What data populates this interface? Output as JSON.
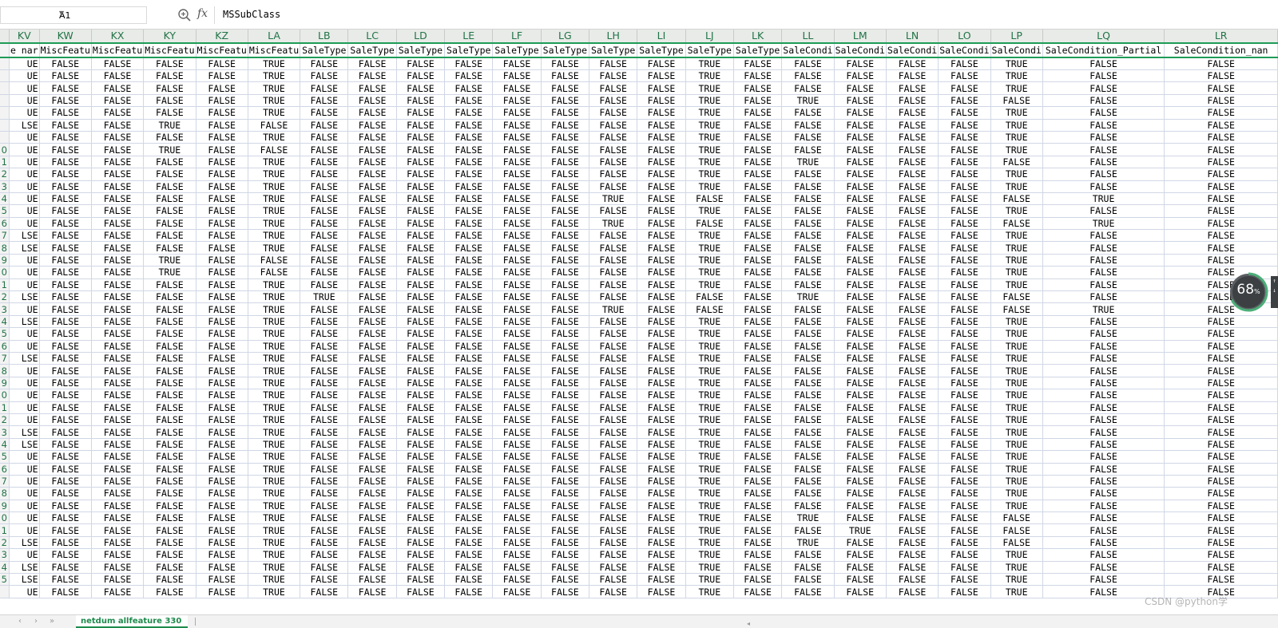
{
  "formula_bar": {
    "name_box": "A1",
    "fx_label": "fx",
    "formula": "MSSubClass"
  },
  "columns": [
    "KV",
    "KW",
    "KX",
    "KY",
    "KZ",
    "LA",
    "LB",
    "LC",
    "LD",
    "LE",
    "LF",
    "LG",
    "LH",
    "LI",
    "LJ",
    "LK",
    "LL",
    "LM",
    "LN",
    "LO",
    "LP",
    "LQ",
    "LR"
  ],
  "header_row": [
    "e nar",
    "MiscFeatu",
    "MiscFeatu",
    "MiscFeatu",
    "MiscFeatu",
    "MiscFeatu",
    "SaleType",
    "SaleType",
    "SaleType",
    "SaleType",
    "SaleType",
    "SaleType",
    "SaleType",
    "SaleType",
    "SaleType",
    "SaleType",
    "SaleCondi",
    "SaleCondi",
    "SaleCondi",
    "SaleCondi",
    "SaleCondi",
    "SaleCondition_Partial",
    "SaleCondition_nan"
  ],
  "row_numbers": [
    "",
    "",
    "",
    "",
    "",
    "",
    "",
    "",
    "0",
    "1",
    "2",
    "3",
    "4",
    "5",
    "6",
    "7",
    "8",
    "9",
    "0",
    "1",
    "2",
    "3",
    "4",
    "5",
    "6",
    "7",
    "8",
    "9",
    "0",
    "1",
    "2",
    "3",
    "4",
    "5",
    "6",
    "7",
    "8",
    "9",
    "0",
    "1",
    "2",
    "3",
    "4",
    "5"
  ],
  "rows": [
    [
      "UE",
      "FALSE",
      "FALSE",
      "FALSE",
      "FALSE",
      "TRUE",
      "FALSE",
      "FALSE",
      "FALSE",
      "FALSE",
      "FALSE",
      "FALSE",
      "FALSE",
      "FALSE",
      "TRUE",
      "FALSE",
      "FALSE",
      "FALSE",
      "FALSE",
      "FALSE",
      "TRUE",
      "FALSE",
      "FALSE"
    ],
    [
      "UE",
      "FALSE",
      "FALSE",
      "FALSE",
      "FALSE",
      "TRUE",
      "FALSE",
      "FALSE",
      "FALSE",
      "FALSE",
      "FALSE",
      "FALSE",
      "FALSE",
      "FALSE",
      "TRUE",
      "FALSE",
      "FALSE",
      "FALSE",
      "FALSE",
      "FALSE",
      "TRUE",
      "FALSE",
      "FALSE"
    ],
    [
      "UE",
      "FALSE",
      "FALSE",
      "FALSE",
      "FALSE",
      "TRUE",
      "FALSE",
      "FALSE",
      "FALSE",
      "FALSE",
      "FALSE",
      "FALSE",
      "FALSE",
      "FALSE",
      "TRUE",
      "FALSE",
      "FALSE",
      "FALSE",
      "FALSE",
      "FALSE",
      "TRUE",
      "FALSE",
      "FALSE"
    ],
    [
      "UE",
      "FALSE",
      "FALSE",
      "FALSE",
      "FALSE",
      "TRUE",
      "FALSE",
      "FALSE",
      "FALSE",
      "FALSE",
      "FALSE",
      "FALSE",
      "FALSE",
      "FALSE",
      "TRUE",
      "FALSE",
      "TRUE",
      "FALSE",
      "FALSE",
      "FALSE",
      "FALSE",
      "FALSE",
      "FALSE"
    ],
    [
      "UE",
      "FALSE",
      "FALSE",
      "FALSE",
      "FALSE",
      "TRUE",
      "FALSE",
      "FALSE",
      "FALSE",
      "FALSE",
      "FALSE",
      "FALSE",
      "FALSE",
      "FALSE",
      "TRUE",
      "FALSE",
      "FALSE",
      "FALSE",
      "FALSE",
      "FALSE",
      "TRUE",
      "FALSE",
      "FALSE"
    ],
    [
      "LSE",
      "FALSE",
      "FALSE",
      "TRUE",
      "FALSE",
      "FALSE",
      "FALSE",
      "FALSE",
      "FALSE",
      "FALSE",
      "FALSE",
      "FALSE",
      "FALSE",
      "FALSE",
      "TRUE",
      "FALSE",
      "FALSE",
      "FALSE",
      "FALSE",
      "FALSE",
      "TRUE",
      "FALSE",
      "FALSE"
    ],
    [
      "UE",
      "FALSE",
      "FALSE",
      "FALSE",
      "FALSE",
      "TRUE",
      "FALSE",
      "FALSE",
      "FALSE",
      "FALSE",
      "FALSE",
      "FALSE",
      "FALSE",
      "FALSE",
      "TRUE",
      "FALSE",
      "FALSE",
      "FALSE",
      "FALSE",
      "FALSE",
      "TRUE",
      "FALSE",
      "FALSE"
    ],
    [
      "UE",
      "FALSE",
      "FALSE",
      "TRUE",
      "FALSE",
      "FALSE",
      "FALSE",
      "FALSE",
      "FALSE",
      "FALSE",
      "FALSE",
      "FALSE",
      "FALSE",
      "FALSE",
      "TRUE",
      "FALSE",
      "FALSE",
      "FALSE",
      "FALSE",
      "FALSE",
      "TRUE",
      "FALSE",
      "FALSE"
    ],
    [
      "UE",
      "FALSE",
      "FALSE",
      "FALSE",
      "FALSE",
      "TRUE",
      "FALSE",
      "FALSE",
      "FALSE",
      "FALSE",
      "FALSE",
      "FALSE",
      "FALSE",
      "FALSE",
      "TRUE",
      "FALSE",
      "TRUE",
      "FALSE",
      "FALSE",
      "FALSE",
      "FALSE",
      "FALSE",
      "FALSE"
    ],
    [
      "UE",
      "FALSE",
      "FALSE",
      "FALSE",
      "FALSE",
      "TRUE",
      "FALSE",
      "FALSE",
      "FALSE",
      "FALSE",
      "FALSE",
      "FALSE",
      "FALSE",
      "FALSE",
      "TRUE",
      "FALSE",
      "FALSE",
      "FALSE",
      "FALSE",
      "FALSE",
      "TRUE",
      "FALSE",
      "FALSE"
    ],
    [
      "UE",
      "FALSE",
      "FALSE",
      "FALSE",
      "FALSE",
      "TRUE",
      "FALSE",
      "FALSE",
      "FALSE",
      "FALSE",
      "FALSE",
      "FALSE",
      "FALSE",
      "FALSE",
      "TRUE",
      "FALSE",
      "FALSE",
      "FALSE",
      "FALSE",
      "FALSE",
      "TRUE",
      "FALSE",
      "FALSE"
    ],
    [
      "UE",
      "FALSE",
      "FALSE",
      "FALSE",
      "FALSE",
      "TRUE",
      "FALSE",
      "FALSE",
      "FALSE",
      "FALSE",
      "FALSE",
      "FALSE",
      "TRUE",
      "FALSE",
      "FALSE",
      "FALSE",
      "FALSE",
      "FALSE",
      "FALSE",
      "FALSE",
      "FALSE",
      "TRUE",
      "FALSE"
    ],
    [
      "UE",
      "FALSE",
      "FALSE",
      "FALSE",
      "FALSE",
      "TRUE",
      "FALSE",
      "FALSE",
      "FALSE",
      "FALSE",
      "FALSE",
      "FALSE",
      "FALSE",
      "FALSE",
      "TRUE",
      "FALSE",
      "FALSE",
      "FALSE",
      "FALSE",
      "FALSE",
      "TRUE",
      "FALSE",
      "FALSE"
    ],
    [
      "UE",
      "FALSE",
      "FALSE",
      "FALSE",
      "FALSE",
      "TRUE",
      "FALSE",
      "FALSE",
      "FALSE",
      "FALSE",
      "FALSE",
      "FALSE",
      "TRUE",
      "FALSE",
      "FALSE",
      "FALSE",
      "FALSE",
      "FALSE",
      "FALSE",
      "FALSE",
      "FALSE",
      "TRUE",
      "FALSE"
    ],
    [
      "LSE",
      "FALSE",
      "FALSE",
      "FALSE",
      "FALSE",
      "TRUE",
      "FALSE",
      "FALSE",
      "FALSE",
      "FALSE",
      "FALSE",
      "FALSE",
      "FALSE",
      "FALSE",
      "TRUE",
      "FALSE",
      "FALSE",
      "FALSE",
      "FALSE",
      "FALSE",
      "TRUE",
      "FALSE",
      "FALSE"
    ],
    [
      "LSE",
      "FALSE",
      "FALSE",
      "FALSE",
      "FALSE",
      "TRUE",
      "FALSE",
      "FALSE",
      "FALSE",
      "FALSE",
      "FALSE",
      "FALSE",
      "FALSE",
      "FALSE",
      "TRUE",
      "FALSE",
      "FALSE",
      "FALSE",
      "FALSE",
      "FALSE",
      "TRUE",
      "FALSE",
      "FALSE"
    ],
    [
      "UE",
      "FALSE",
      "FALSE",
      "TRUE",
      "FALSE",
      "FALSE",
      "FALSE",
      "FALSE",
      "FALSE",
      "FALSE",
      "FALSE",
      "FALSE",
      "FALSE",
      "FALSE",
      "TRUE",
      "FALSE",
      "FALSE",
      "FALSE",
      "FALSE",
      "FALSE",
      "TRUE",
      "FALSE",
      "FALSE"
    ],
    [
      "UE",
      "FALSE",
      "FALSE",
      "TRUE",
      "FALSE",
      "FALSE",
      "FALSE",
      "FALSE",
      "FALSE",
      "FALSE",
      "FALSE",
      "FALSE",
      "FALSE",
      "FALSE",
      "TRUE",
      "FALSE",
      "FALSE",
      "FALSE",
      "FALSE",
      "FALSE",
      "TRUE",
      "FALSE",
      "FALSE"
    ],
    [
      "UE",
      "FALSE",
      "FALSE",
      "FALSE",
      "FALSE",
      "TRUE",
      "FALSE",
      "FALSE",
      "FALSE",
      "FALSE",
      "FALSE",
      "FALSE",
      "FALSE",
      "FALSE",
      "TRUE",
      "FALSE",
      "FALSE",
      "FALSE",
      "FALSE",
      "FALSE",
      "TRUE",
      "FALSE",
      "FALSE"
    ],
    [
      "LSE",
      "FALSE",
      "FALSE",
      "FALSE",
      "FALSE",
      "TRUE",
      "TRUE",
      "FALSE",
      "FALSE",
      "FALSE",
      "FALSE",
      "FALSE",
      "FALSE",
      "FALSE",
      "FALSE",
      "FALSE",
      "TRUE",
      "FALSE",
      "FALSE",
      "FALSE",
      "FALSE",
      "FALSE",
      "FALSE"
    ],
    [
      "UE",
      "FALSE",
      "FALSE",
      "FALSE",
      "FALSE",
      "TRUE",
      "FALSE",
      "FALSE",
      "FALSE",
      "FALSE",
      "FALSE",
      "FALSE",
      "TRUE",
      "FALSE",
      "FALSE",
      "FALSE",
      "FALSE",
      "FALSE",
      "FALSE",
      "FALSE",
      "FALSE",
      "TRUE",
      "FALSE"
    ],
    [
      "LSE",
      "FALSE",
      "FALSE",
      "FALSE",
      "FALSE",
      "TRUE",
      "FALSE",
      "FALSE",
      "FALSE",
      "FALSE",
      "FALSE",
      "FALSE",
      "FALSE",
      "FALSE",
      "TRUE",
      "FALSE",
      "FALSE",
      "FALSE",
      "FALSE",
      "FALSE",
      "TRUE",
      "FALSE",
      "FALSE"
    ],
    [
      "UE",
      "FALSE",
      "FALSE",
      "FALSE",
      "FALSE",
      "TRUE",
      "FALSE",
      "FALSE",
      "FALSE",
      "FALSE",
      "FALSE",
      "FALSE",
      "FALSE",
      "FALSE",
      "TRUE",
      "FALSE",
      "FALSE",
      "FALSE",
      "FALSE",
      "FALSE",
      "TRUE",
      "FALSE",
      "FALSE"
    ],
    [
      "UE",
      "FALSE",
      "FALSE",
      "FALSE",
      "FALSE",
      "TRUE",
      "FALSE",
      "FALSE",
      "FALSE",
      "FALSE",
      "FALSE",
      "FALSE",
      "FALSE",
      "FALSE",
      "TRUE",
      "FALSE",
      "FALSE",
      "FALSE",
      "FALSE",
      "FALSE",
      "TRUE",
      "FALSE",
      "FALSE"
    ],
    [
      "LSE",
      "FALSE",
      "FALSE",
      "FALSE",
      "FALSE",
      "TRUE",
      "FALSE",
      "FALSE",
      "FALSE",
      "FALSE",
      "FALSE",
      "FALSE",
      "FALSE",
      "FALSE",
      "TRUE",
      "FALSE",
      "FALSE",
      "FALSE",
      "FALSE",
      "FALSE",
      "TRUE",
      "FALSE",
      "FALSE"
    ],
    [
      "UE",
      "FALSE",
      "FALSE",
      "FALSE",
      "FALSE",
      "TRUE",
      "FALSE",
      "FALSE",
      "FALSE",
      "FALSE",
      "FALSE",
      "FALSE",
      "FALSE",
      "FALSE",
      "TRUE",
      "FALSE",
      "FALSE",
      "FALSE",
      "FALSE",
      "FALSE",
      "TRUE",
      "FALSE",
      "FALSE"
    ],
    [
      "UE",
      "FALSE",
      "FALSE",
      "FALSE",
      "FALSE",
      "TRUE",
      "FALSE",
      "FALSE",
      "FALSE",
      "FALSE",
      "FALSE",
      "FALSE",
      "FALSE",
      "FALSE",
      "TRUE",
      "FALSE",
      "FALSE",
      "FALSE",
      "FALSE",
      "FALSE",
      "TRUE",
      "FALSE",
      "FALSE"
    ],
    [
      "UE",
      "FALSE",
      "FALSE",
      "FALSE",
      "FALSE",
      "TRUE",
      "FALSE",
      "FALSE",
      "FALSE",
      "FALSE",
      "FALSE",
      "FALSE",
      "FALSE",
      "FALSE",
      "TRUE",
      "FALSE",
      "FALSE",
      "FALSE",
      "FALSE",
      "FALSE",
      "TRUE",
      "FALSE",
      "FALSE"
    ],
    [
      "UE",
      "FALSE",
      "FALSE",
      "FALSE",
      "FALSE",
      "TRUE",
      "FALSE",
      "FALSE",
      "FALSE",
      "FALSE",
      "FALSE",
      "FALSE",
      "FALSE",
      "FALSE",
      "TRUE",
      "FALSE",
      "FALSE",
      "FALSE",
      "FALSE",
      "FALSE",
      "TRUE",
      "FALSE",
      "FALSE"
    ],
    [
      "UE",
      "FALSE",
      "FALSE",
      "FALSE",
      "FALSE",
      "TRUE",
      "FALSE",
      "FALSE",
      "FALSE",
      "FALSE",
      "FALSE",
      "FALSE",
      "FALSE",
      "FALSE",
      "TRUE",
      "FALSE",
      "FALSE",
      "FALSE",
      "FALSE",
      "FALSE",
      "TRUE",
      "FALSE",
      "FALSE"
    ],
    [
      "LSE",
      "FALSE",
      "FALSE",
      "FALSE",
      "FALSE",
      "TRUE",
      "FALSE",
      "FALSE",
      "FALSE",
      "FALSE",
      "FALSE",
      "FALSE",
      "FALSE",
      "FALSE",
      "TRUE",
      "FALSE",
      "FALSE",
      "FALSE",
      "FALSE",
      "FALSE",
      "TRUE",
      "FALSE",
      "FALSE"
    ],
    [
      "LSE",
      "FALSE",
      "FALSE",
      "FALSE",
      "FALSE",
      "TRUE",
      "FALSE",
      "FALSE",
      "FALSE",
      "FALSE",
      "FALSE",
      "FALSE",
      "FALSE",
      "FALSE",
      "TRUE",
      "FALSE",
      "FALSE",
      "FALSE",
      "FALSE",
      "FALSE",
      "TRUE",
      "FALSE",
      "FALSE"
    ],
    [
      "UE",
      "FALSE",
      "FALSE",
      "FALSE",
      "FALSE",
      "TRUE",
      "FALSE",
      "FALSE",
      "FALSE",
      "FALSE",
      "FALSE",
      "FALSE",
      "FALSE",
      "FALSE",
      "TRUE",
      "FALSE",
      "FALSE",
      "FALSE",
      "FALSE",
      "FALSE",
      "TRUE",
      "FALSE",
      "FALSE"
    ],
    [
      "UE",
      "FALSE",
      "FALSE",
      "FALSE",
      "FALSE",
      "TRUE",
      "FALSE",
      "FALSE",
      "FALSE",
      "FALSE",
      "FALSE",
      "FALSE",
      "FALSE",
      "FALSE",
      "TRUE",
      "FALSE",
      "FALSE",
      "FALSE",
      "FALSE",
      "FALSE",
      "TRUE",
      "FALSE",
      "FALSE"
    ],
    [
      "UE",
      "FALSE",
      "FALSE",
      "FALSE",
      "FALSE",
      "TRUE",
      "FALSE",
      "FALSE",
      "FALSE",
      "FALSE",
      "FALSE",
      "FALSE",
      "FALSE",
      "FALSE",
      "TRUE",
      "FALSE",
      "FALSE",
      "FALSE",
      "FALSE",
      "FALSE",
      "TRUE",
      "FALSE",
      "FALSE"
    ],
    [
      "UE",
      "FALSE",
      "FALSE",
      "FALSE",
      "FALSE",
      "TRUE",
      "FALSE",
      "FALSE",
      "FALSE",
      "FALSE",
      "FALSE",
      "FALSE",
      "FALSE",
      "FALSE",
      "TRUE",
      "FALSE",
      "FALSE",
      "FALSE",
      "FALSE",
      "FALSE",
      "TRUE",
      "FALSE",
      "FALSE"
    ],
    [
      "UE",
      "FALSE",
      "FALSE",
      "FALSE",
      "FALSE",
      "TRUE",
      "FALSE",
      "FALSE",
      "FALSE",
      "FALSE",
      "FALSE",
      "FALSE",
      "FALSE",
      "FALSE",
      "TRUE",
      "FALSE",
      "FALSE",
      "FALSE",
      "FALSE",
      "FALSE",
      "TRUE",
      "FALSE",
      "FALSE"
    ],
    [
      "UE",
      "FALSE",
      "FALSE",
      "FALSE",
      "FALSE",
      "TRUE",
      "FALSE",
      "FALSE",
      "FALSE",
      "FALSE",
      "FALSE",
      "FALSE",
      "FALSE",
      "FALSE",
      "TRUE",
      "FALSE",
      "TRUE",
      "FALSE",
      "FALSE",
      "FALSE",
      "FALSE",
      "FALSE",
      "FALSE"
    ],
    [
      "UE",
      "FALSE",
      "FALSE",
      "FALSE",
      "FALSE",
      "TRUE",
      "FALSE",
      "FALSE",
      "FALSE",
      "FALSE",
      "FALSE",
      "FALSE",
      "FALSE",
      "FALSE",
      "TRUE",
      "FALSE",
      "FALSE",
      "TRUE",
      "FALSE",
      "FALSE",
      "FALSE",
      "FALSE",
      "FALSE"
    ],
    [
      "LSE",
      "FALSE",
      "FALSE",
      "FALSE",
      "FALSE",
      "TRUE",
      "FALSE",
      "FALSE",
      "FALSE",
      "FALSE",
      "FALSE",
      "FALSE",
      "FALSE",
      "FALSE",
      "TRUE",
      "FALSE",
      "TRUE",
      "FALSE",
      "FALSE",
      "FALSE",
      "FALSE",
      "FALSE",
      "FALSE"
    ],
    [
      "UE",
      "FALSE",
      "FALSE",
      "FALSE",
      "FALSE",
      "TRUE",
      "FALSE",
      "FALSE",
      "FALSE",
      "FALSE",
      "FALSE",
      "FALSE",
      "FALSE",
      "FALSE",
      "TRUE",
      "FALSE",
      "FALSE",
      "FALSE",
      "FALSE",
      "FALSE",
      "TRUE",
      "FALSE",
      "FALSE"
    ],
    [
      "LSE",
      "FALSE",
      "FALSE",
      "FALSE",
      "FALSE",
      "TRUE",
      "FALSE",
      "FALSE",
      "FALSE",
      "FALSE",
      "FALSE",
      "FALSE",
      "FALSE",
      "FALSE",
      "TRUE",
      "FALSE",
      "FALSE",
      "FALSE",
      "FALSE",
      "FALSE",
      "TRUE",
      "FALSE",
      "FALSE"
    ],
    [
      "LSE",
      "FALSE",
      "FALSE",
      "FALSE",
      "FALSE",
      "TRUE",
      "FALSE",
      "FALSE",
      "FALSE",
      "FALSE",
      "FALSE",
      "FALSE",
      "FALSE",
      "FALSE",
      "TRUE",
      "FALSE",
      "FALSE",
      "FALSE",
      "FALSE",
      "FALSE",
      "TRUE",
      "FALSE",
      "FALSE"
    ],
    [
      "UE",
      "FALSE",
      "FALSE",
      "FALSE",
      "FALSE",
      "TRUE",
      "FALSE",
      "FALSE",
      "FALSE",
      "FALSE",
      "FALSE",
      "FALSE",
      "FALSE",
      "FALSE",
      "TRUE",
      "FALSE",
      "FALSE",
      "FALSE",
      "FALSE",
      "FALSE",
      "TRUE",
      "FALSE",
      "FALSE"
    ]
  ],
  "tabbar": {
    "sheet_tab": "netdum allfeature 330"
  },
  "widget": {
    "value": "68",
    "unit": "%"
  },
  "watermark": "CSDN @python学",
  "colors": {
    "accent": "#217346",
    "selection_border": "#1f9b58",
    "grid": "#d0d7e5"
  }
}
